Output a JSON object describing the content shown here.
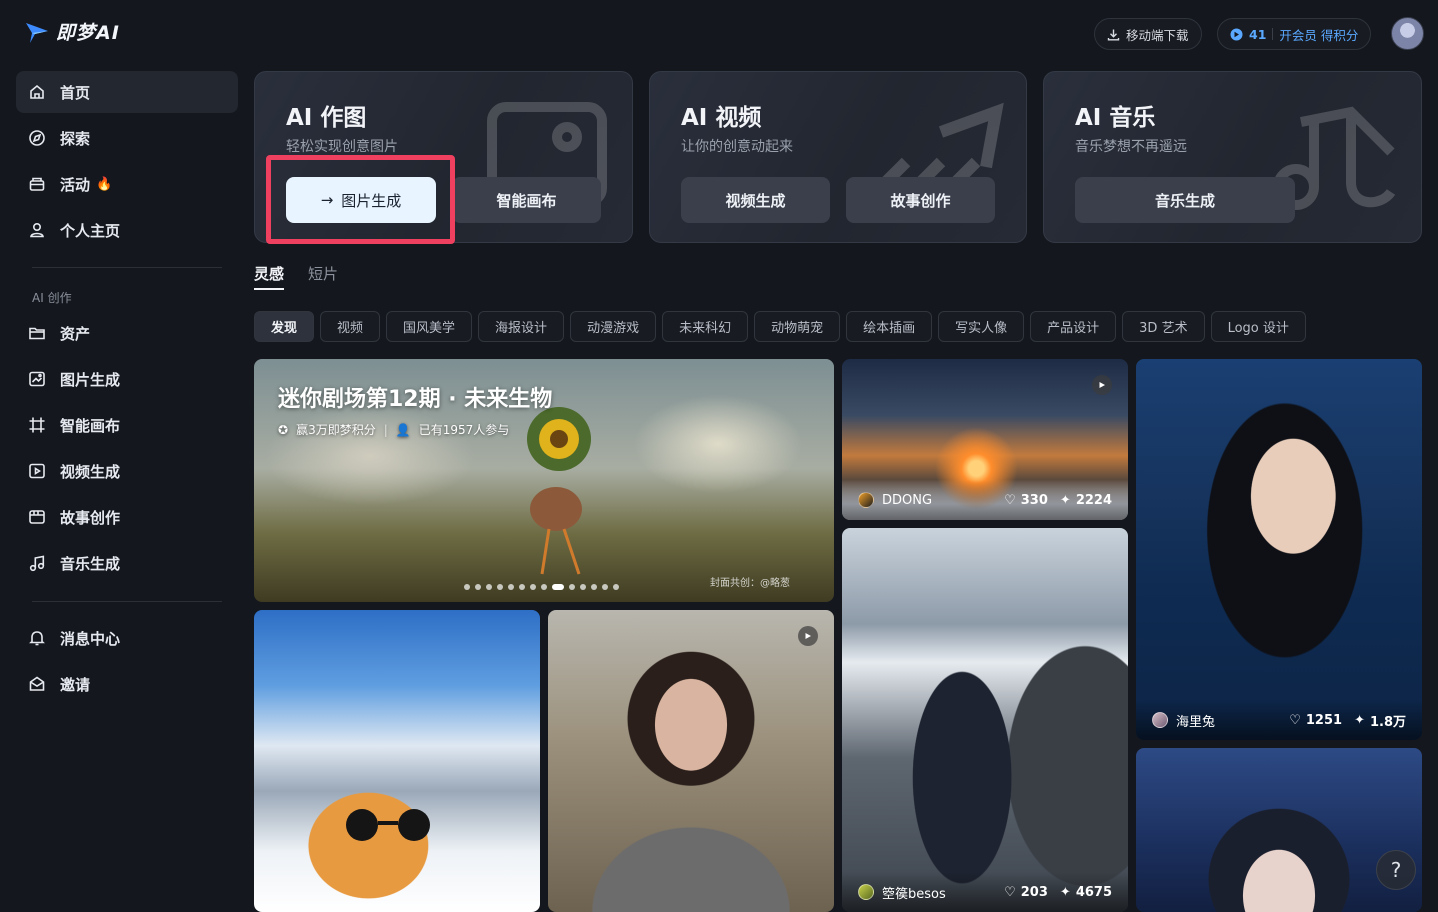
{
  "app": {
    "logo_text": "即梦AI"
  },
  "sidebar": {
    "main": [
      {
        "label": "首页",
        "icon": "home-icon"
      },
      {
        "label": "探索",
        "icon": "compass-icon"
      },
      {
        "label": "活动",
        "icon": "gift-icon",
        "badge": "🔥"
      },
      {
        "label": "个人主页",
        "icon": "user-icon"
      }
    ],
    "section_label": "AI 创作",
    "create": [
      {
        "label": "资产",
        "icon": "folder-icon"
      },
      {
        "label": "图片生成",
        "icon": "image-gen-icon"
      },
      {
        "label": "智能画布",
        "icon": "canvas-icon"
      },
      {
        "label": "视频生成",
        "icon": "video-gen-icon"
      },
      {
        "label": "故事创作",
        "icon": "story-icon"
      },
      {
        "label": "音乐生成",
        "icon": "music-icon"
      }
    ],
    "bottom": [
      {
        "label": "消息中心",
        "icon": "bell-icon"
      },
      {
        "label": "邀请",
        "icon": "invite-icon"
      }
    ]
  },
  "topbar": {
    "download_label": "移动端下载",
    "points": "41",
    "vip_label": "开会员 得积分"
  },
  "cards": [
    {
      "title": "AI 作图",
      "subtitle": "轻松实现创意图片",
      "buttons": [
        "图片生成",
        "智能画布"
      ]
    },
    {
      "title": "AI 视频",
      "subtitle": "让你的创意动起来",
      "buttons": [
        "视频生成",
        "故事创作"
      ]
    },
    {
      "title": "AI 音乐",
      "subtitle": "音乐梦想不再遥远",
      "buttons": [
        "音乐生成"
      ]
    }
  ],
  "tabs": [
    "灵感",
    "短片"
  ],
  "chips": [
    "发现",
    "视频",
    "国风美学",
    "海报设计",
    "动漫游戏",
    "未来科幻",
    "动物萌宠",
    "绘本插画",
    "写实人像",
    "产品设计",
    "3D 艺术",
    "Logo 设计"
  ],
  "banner": {
    "title": "迷你剧场第12期 · 未来生物",
    "reward": "赢3万即梦积分",
    "participants": "已有1957人参与",
    "credit": "封面共创：@略葱",
    "dot_count": 14,
    "active_dot": 8
  },
  "tiles": {
    "sunset": {
      "user": "DDONG",
      "likes": "330",
      "uses": "2224"
    },
    "portrait_blue": {
      "user": "海里兔",
      "likes": "1251",
      "uses": "1.8万"
    },
    "hiker": {
      "user": "箜篌besos",
      "likes": "203",
      "uses": "4675"
    }
  },
  "help_label": "?"
}
